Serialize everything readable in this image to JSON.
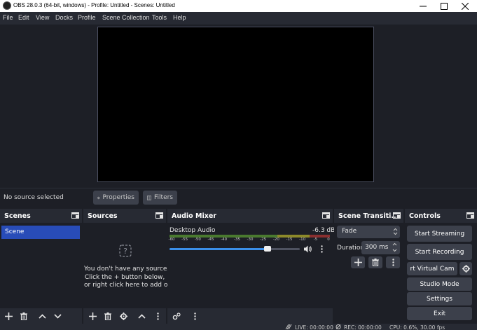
{
  "window": {
    "title": "OBS 28.0.3 (64-bit, windows) - Profile: Untitled - Scenes: Untitled"
  },
  "menu": [
    "File",
    "Edit",
    "View",
    "Docks",
    "Profile",
    "Scene Collection",
    "Tools",
    "Help"
  ],
  "context_bar": {
    "no_source": "No source selected",
    "properties": "Properties",
    "filters": "Filters"
  },
  "docks": {
    "scenes": {
      "title": "Scenes",
      "items": [
        "Scene"
      ]
    },
    "sources": {
      "title": "Sources",
      "empty_lines": [
        "You don't have any sources.",
        "Click the + button below,",
        "or right click here to add one."
      ]
    },
    "audio_mixer": {
      "title": "Audio Mixer",
      "channel": {
        "name": "Desktop Audio",
        "level": "-6.3 dB",
        "volume_fraction": 0.75,
        "ticks": [
          "-60",
          "-55",
          "-50",
          "-45",
          "-40",
          "-35",
          "-30",
          "-25",
          "-20",
          "-15",
          "-10",
          "-5",
          "0"
        ]
      }
    },
    "scene_transitions": {
      "title": "Scene Transiti...",
      "transition": "Fade",
      "duration_label": "Duration",
      "duration_value": "300 ms"
    },
    "controls": {
      "title": "Controls",
      "start_streaming": "Start Streaming",
      "start_recording": "Start Recording",
      "virtual_cam": "rt Virtual Cam",
      "studio_mode": "Studio Mode",
      "settings": "Settings",
      "exit": "Exit"
    }
  },
  "status": {
    "live": "LIVE: 00:00:00",
    "rec": "REC: 00:00:00",
    "cpu": "CPU: 0.6%, 30.00 fps"
  },
  "colors": {
    "accent": "#284cb8",
    "slider": "#3b8fe8",
    "meter_green": "#4a7a2f",
    "meter_yellow": "#8d8a2a",
    "meter_red": "#8a2f2f"
  }
}
